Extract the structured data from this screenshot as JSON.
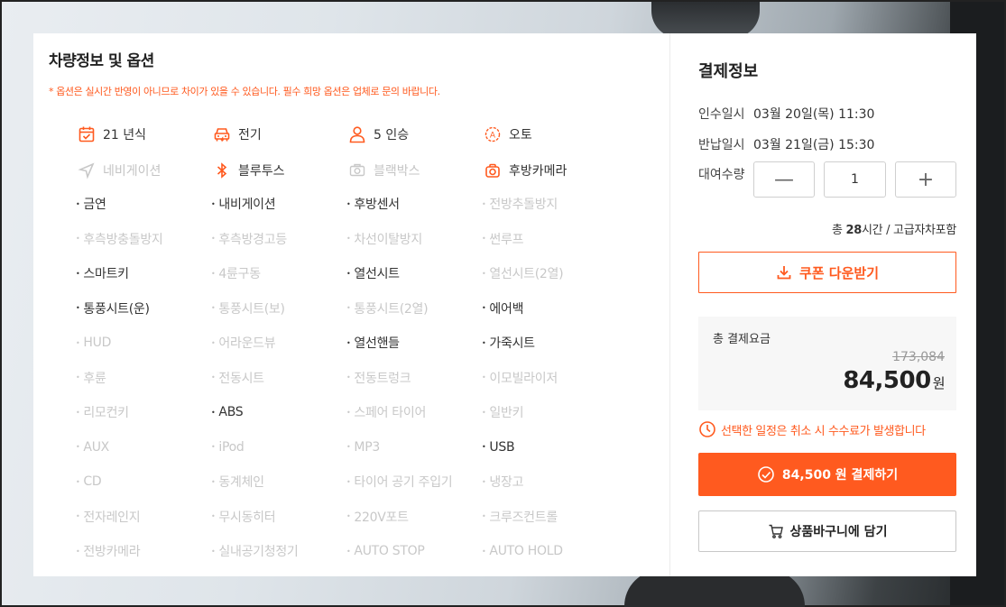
{
  "vehicle": {
    "title": "차량정보 및 옵션",
    "notice": "* 옵션은 실시간 반영이 아니므로 차이가 있을 수 있습니다. 필수 희망 옵션은 업체로 문의 바랍니다.",
    "features_row1": [
      {
        "label": "21 년식",
        "icon": "calendar-icon",
        "active": true
      },
      {
        "label": "전기",
        "icon": "car-icon",
        "active": true
      },
      {
        "label": "5 인승",
        "icon": "person-icon",
        "active": true
      },
      {
        "label": "오토",
        "icon": "auto-icon",
        "active": true
      }
    ],
    "features_row2": [
      {
        "label": "네비게이션",
        "icon": "navigation-icon",
        "active": false
      },
      {
        "label": "블루투스",
        "icon": "bluetooth-icon",
        "active": true
      },
      {
        "label": "블랙박스",
        "icon": "dashcam-icon",
        "active": false
      },
      {
        "label": "후방카메라",
        "icon": "camera-icon",
        "active": true
      }
    ],
    "options": [
      {
        "label": "금연",
        "active": true
      },
      {
        "label": "내비게이션",
        "active": true
      },
      {
        "label": "후방센서",
        "active": true
      },
      {
        "label": "전방추돌방지",
        "active": false
      },
      {
        "label": "후측방충돌방지",
        "active": false
      },
      {
        "label": "후측방경고등",
        "active": false
      },
      {
        "label": "차선이탈방지",
        "active": false
      },
      {
        "label": "썬루프",
        "active": false
      },
      {
        "label": "스마트키",
        "active": true
      },
      {
        "label": "4륜구동",
        "active": false
      },
      {
        "label": "열선시트",
        "active": true
      },
      {
        "label": "열선시트(2열)",
        "active": false
      },
      {
        "label": "통풍시트(운)",
        "active": true
      },
      {
        "label": "통풍시트(보)",
        "active": false
      },
      {
        "label": "통풍시트(2열)",
        "active": false
      },
      {
        "label": "에어백",
        "active": true
      },
      {
        "label": "HUD",
        "active": false
      },
      {
        "label": "어라운드뷰",
        "active": false
      },
      {
        "label": "열선핸들",
        "active": true
      },
      {
        "label": "가죽시트",
        "active": true
      },
      {
        "label": "후륜",
        "active": false
      },
      {
        "label": "전동시트",
        "active": false
      },
      {
        "label": "전동트렁크",
        "active": false
      },
      {
        "label": "이모빌라이저",
        "active": false
      },
      {
        "label": "리모컨키",
        "active": false
      },
      {
        "label": "ABS",
        "active": true
      },
      {
        "label": "스페어 타이어",
        "active": false
      },
      {
        "label": "일반키",
        "active": false
      },
      {
        "label": "AUX",
        "active": false
      },
      {
        "label": "iPod",
        "active": false
      },
      {
        "label": "MP3",
        "active": false
      },
      {
        "label": "USB",
        "active": true
      },
      {
        "label": "CD",
        "active": false
      },
      {
        "label": "동계체인",
        "active": false
      },
      {
        "label": "타이어 공기 주입기",
        "active": false
      },
      {
        "label": "냉장고",
        "active": false
      },
      {
        "label": "전자레인지",
        "active": false
      },
      {
        "label": "무시동히터",
        "active": false
      },
      {
        "label": "220V포트",
        "active": false
      },
      {
        "label": "크루즈컨트롤",
        "active": false
      },
      {
        "label": "전방카메라",
        "active": false
      },
      {
        "label": "실내공기청정기",
        "active": false
      },
      {
        "label": "AUTO STOP",
        "active": false
      },
      {
        "label": "AUTO HOLD",
        "active": false
      }
    ]
  },
  "payment": {
    "title": "결제정보",
    "pickup_label": "인수일시",
    "pickup_value": "03월 20일(목) 11:30",
    "return_label": "반납일시",
    "return_value": "03월 21일(금) 15:30",
    "qty_label": "대여수량",
    "qty_minus": "—",
    "qty_value": "1",
    "qty_plus": "+",
    "total_time_prefix": "총 ",
    "total_time_hours": "28",
    "total_time_suffix": "시간 / 고급자차포함",
    "coupon_label": "쿠폰 다운받기",
    "total_label": "총 결제요금",
    "original_price": "173,084",
    "final_price": "84,500",
    "currency": "원",
    "warning": "선택한 일정은 취소 시 수수료가 발생합니다",
    "pay_button": "84,500 원 결제하기",
    "cart_button": "상품바구니에 담기",
    "accent_color": "#ff5a1f"
  }
}
